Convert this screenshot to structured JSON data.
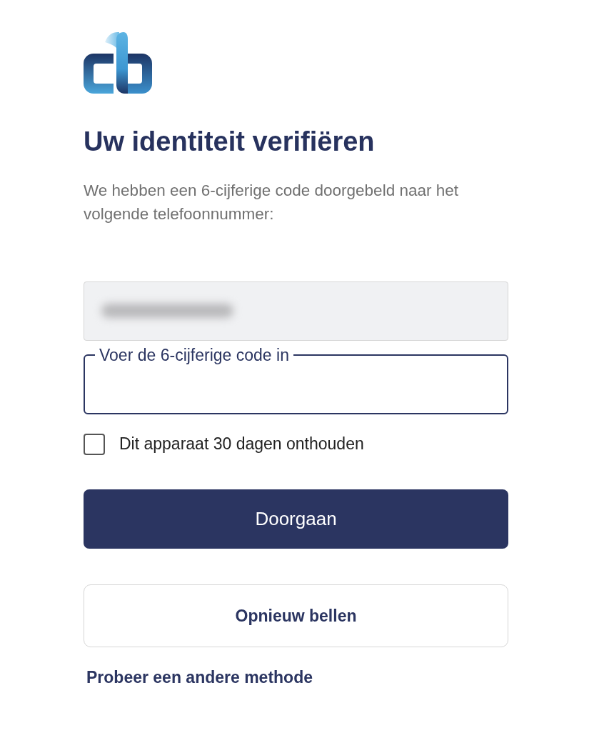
{
  "title": "Uw identiteit verifiëren",
  "message": "We hebben een 6-cijferige code doorgebeld naar het volgende telefoonnummer:",
  "phone_field": {
    "disabled": true,
    "value_hidden": true
  },
  "code_field": {
    "label": "Voer de 6-cijferige code in",
    "focused": true
  },
  "remember_device": {
    "label": "Dit apparaat 30 dagen onthouden",
    "checked": false
  },
  "buttons": [
    {
      "label": "Doorgaan",
      "kind": "primary"
    },
    {
      "label": "Opnieuw bellen",
      "kind": "secondary"
    }
  ],
  "link": "Probeer een andere methode"
}
